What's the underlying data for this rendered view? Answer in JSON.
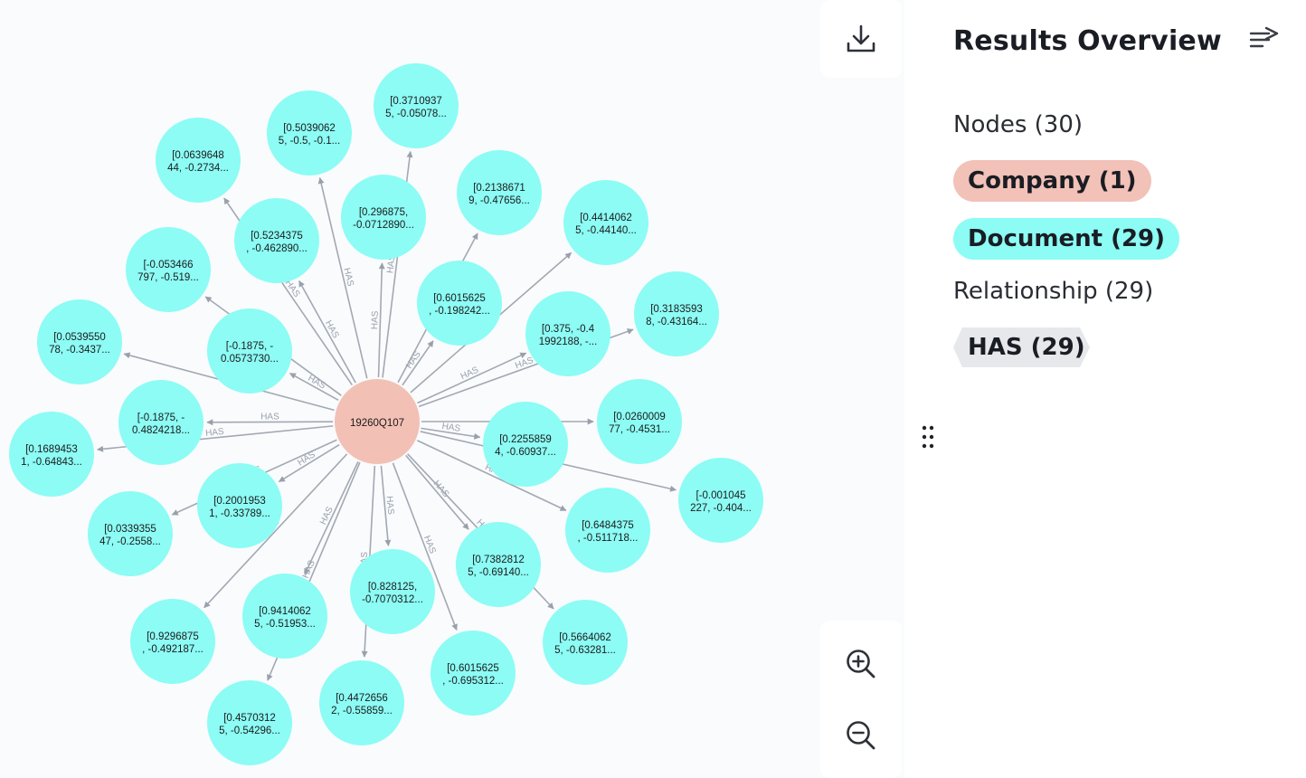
{
  "graph": {
    "center": {
      "label": "19260Q107",
      "color": "#f3c0b5"
    },
    "document_color": "#8cfcf5",
    "edge_label": "HAS",
    "documents": [
      [
        "[0.3710937",
        "5, -0.05078..."
      ],
      [
        "[0.5039062",
        "5, -0.5, -0.1..."
      ],
      [
        "[0.0639648",
        "44, -0.2734..."
      ],
      [
        "[0.296875,",
        "-0.0712890..."
      ],
      [
        "[0.2138671",
        "9, -0.47656..."
      ],
      [
        "[0.4414062",
        "5, -0.44140..."
      ],
      [
        "[0.5234375",
        ", -0.462890..."
      ],
      [
        "[-0.053466",
        "797, -0.519..."
      ],
      [
        "[0.6015625",
        ", -0.198242..."
      ],
      [
        "[0.3183593",
        "8, -0.43164..."
      ],
      [
        "[0.375, -0.4",
        "1992188, -..."
      ],
      [
        "[0.0539550",
        "78, -0.3437..."
      ],
      [
        "[-0.1875, -",
        "0.0573730..."
      ],
      [
        "[-0.1875, -",
        "0.4824218..."
      ],
      [
        "[0.1689453",
        "1, -0.64843..."
      ],
      [
        "[0.0260009",
        "77, -0.4531..."
      ],
      [
        "[0.2255859",
        "4, -0.60937..."
      ],
      [
        "[-0.001045",
        "227, -0.404..."
      ],
      [
        "[0.2001953",
        "1, -0.33789..."
      ],
      [
        "[0.0339355",
        "47, -0.2558..."
      ],
      [
        "[0.6484375",
        ", -0.511718..."
      ],
      [
        "[0.7382812",
        "5, -0.69140..."
      ],
      [
        "[0.828125,",
        "-0.7070312..."
      ],
      [
        "[0.9414062",
        "5, -0.51953..."
      ],
      [
        "[0.9296875",
        ", -0.492187..."
      ],
      [
        "[0.5664062",
        "5, -0.63281..."
      ],
      [
        "[0.6015625",
        ", -0.695312..."
      ],
      [
        "[0.4472656",
        "2, -0.55859..."
      ],
      [
        "[0.4570312",
        "5, -0.54296..."
      ]
    ]
  },
  "toolbar": {
    "download_icon": "download-icon",
    "zoom_in_icon": "zoom-in-icon",
    "zoom_out_icon": "zoom-out-icon"
  },
  "panel": {
    "title": "Results Overview",
    "nodes_heading": "Nodes (30)",
    "labels": [
      {
        "text": "Company (1)",
        "color": "#f2c1b7"
      },
      {
        "text": "Document (29)",
        "color": "#8cfcf5"
      }
    ],
    "relationships_heading": "Relationship (29)",
    "relationship_types": [
      {
        "text": "HAS (29)",
        "color": "#e6e8ec"
      }
    ]
  }
}
